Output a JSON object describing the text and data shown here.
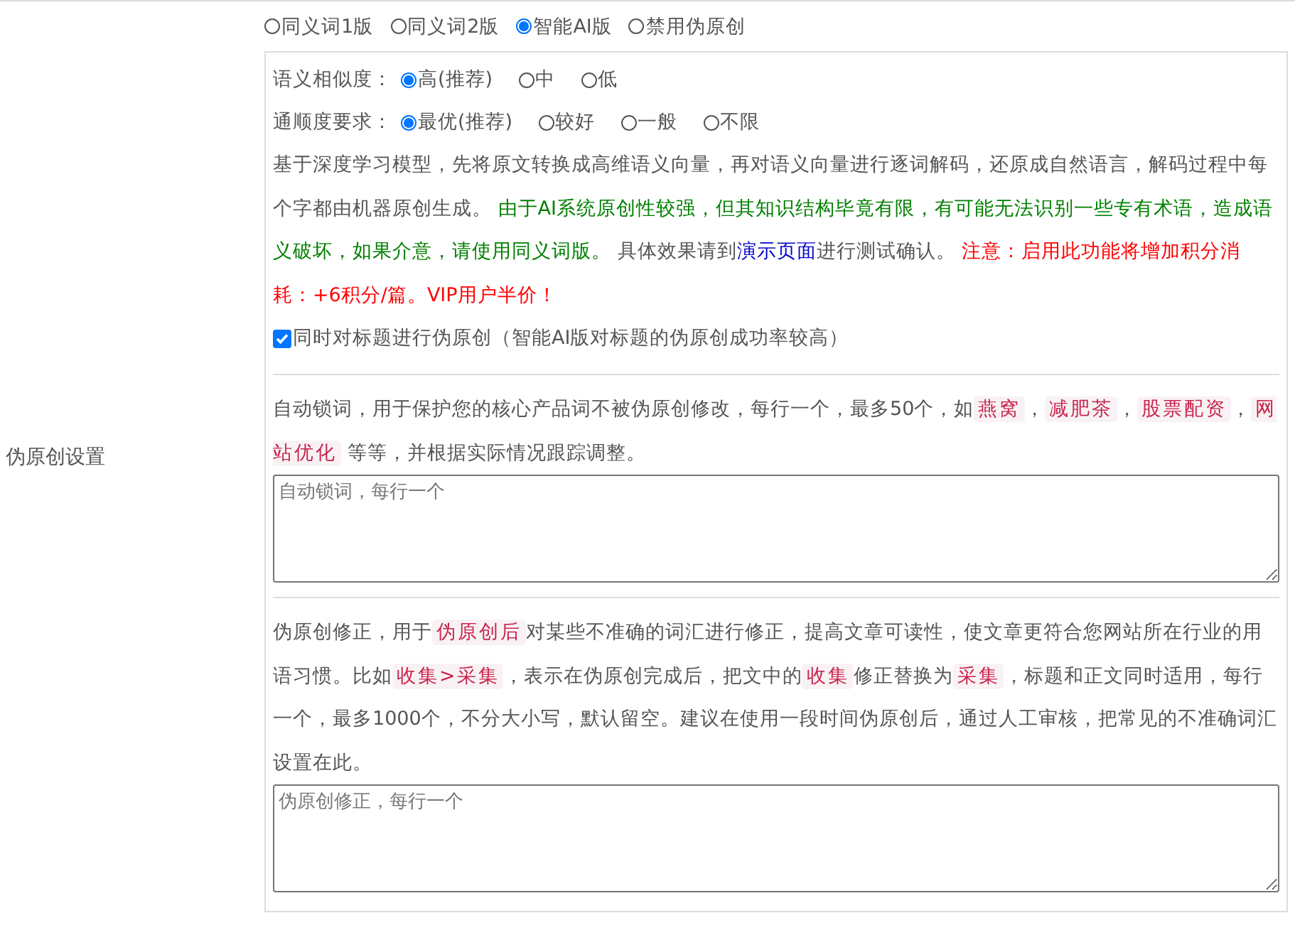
{
  "label": "伪原创设置",
  "modes": [
    {
      "label": "同义词1版",
      "selected": false
    },
    {
      "label": "同义词2版",
      "selected": false
    },
    {
      "label": "智能AI版",
      "selected": true
    },
    {
      "label": "禁用伪原创",
      "selected": false
    }
  ],
  "option_groups": [
    {
      "label": "语义相似度：",
      "options": [
        {
          "label": "高(推荐)",
          "selected": true
        },
        {
          "label": "中",
          "selected": false
        },
        {
          "label": "低",
          "selected": false
        }
      ]
    },
    {
      "label": "通顺度要求：",
      "options": [
        {
          "label": "最优(推荐)",
          "selected": true
        },
        {
          "label": "较好",
          "selected": false
        },
        {
          "label": "一般",
          "selected": false
        },
        {
          "label": "不限",
          "selected": false
        }
      ]
    }
  ],
  "ai_description": [
    {
      "kind": "plain",
      "text": "基于深度学习模型，先将原文转换成高维语义向量，再对语义向量进行逐词解码，还原成自然语言，解码过程中每个字都由机器原创生成。 "
    },
    {
      "kind": "green",
      "text": "由于AI系统原创性较强，但其知识结构毕竟有限，有可能无法识别一些专有术语，造成语义破坏，如果介意，请使用同义词版。"
    },
    {
      "kind": "plain",
      "text": " 具体效果请到"
    },
    {
      "kind": "link",
      "text": "演示页面"
    },
    {
      "kind": "plain",
      "text": "进行测试确认。 "
    },
    {
      "kind": "red",
      "text": "注意：启用此功能将增加积分消耗：+6积分/篇。VIP用户半价！"
    }
  ],
  "title_checkbox": {
    "label": "同时对标题进行伪原创（智能AI版对标题的伪原创成功率较高）",
    "checked": true
  },
  "sections": [
    {
      "description": [
        {
          "kind": "plain",
          "text": "自动锁词，用于保护您的核心产品词不被伪原创修改，每行一个，最多50个，如"
        },
        {
          "kind": "code",
          "text": "燕窝"
        },
        {
          "kind": "plain",
          "text": "，"
        },
        {
          "kind": "code",
          "text": "减肥茶"
        },
        {
          "kind": "plain",
          "text": "，"
        },
        {
          "kind": "code",
          "text": "股票配资"
        },
        {
          "kind": "plain",
          "text": "，"
        },
        {
          "kind": "code",
          "text": "网站优化"
        },
        {
          "kind": "plain",
          "text": " 等等，并根据实际情况跟踪调整。"
        }
      ],
      "placeholder": "自动锁词，每行一个"
    },
    {
      "description": [
        {
          "kind": "plain",
          "text": "伪原创修正，用于"
        },
        {
          "kind": "code",
          "text": "伪原创后"
        },
        {
          "kind": "plain",
          "text": "对某些不准确的词汇进行修正，提高文章可读性，使文章更符合您网站所在行业的用语习惯。比如"
        },
        {
          "kind": "code",
          "text": "收集>采集"
        },
        {
          "kind": "plain",
          "text": "，表示在伪原创完成后，把文中的"
        },
        {
          "kind": "code",
          "text": "收集"
        },
        {
          "kind": "plain",
          "text": "修正替换为"
        },
        {
          "kind": "code",
          "text": "采集"
        },
        {
          "kind": "plain",
          "text": "，标题和正文同时适用，每行一个，最多1000个，不分大小写，默认留空。建议在使用一段时间伪原创后，通过人工审核，把常见的不准确词汇设置在此。"
        }
      ],
      "placeholder": "伪原创修正，每行一个"
    }
  ]
}
